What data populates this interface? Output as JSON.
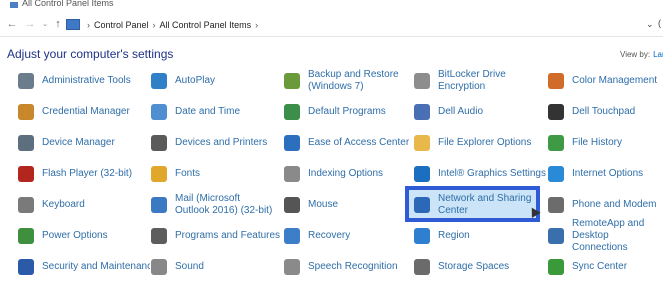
{
  "window": {
    "title": "All Control Panel Items"
  },
  "nav": {
    "back": "←",
    "forward": "→",
    "recent": "⌄",
    "up": "↑"
  },
  "address": {
    "crumbs": [
      "Control Panel",
      "All Control Panel Items"
    ],
    "separator": "›",
    "dropdown": "⌄",
    "refresh": "("
  },
  "heading": "Adjust your computer's settings",
  "view_by": {
    "label": "View by:",
    "value": "Larg"
  },
  "items": [
    {
      "label": "Administrative Tools",
      "icon": "administrative-tools-icon",
      "color": "#6b7d8c"
    },
    {
      "label": "AutoPlay",
      "icon": "autoplay-icon",
      "color": "#2f80c7"
    },
    {
      "label": "Backup and Restore (Windows 7)",
      "icon": "backup-restore-icon",
      "color": "#6a9a3a"
    },
    {
      "label": "BitLocker Drive Encryption",
      "icon": "bitlocker-icon",
      "color": "#8d8d8d"
    },
    {
      "label": "Color Management",
      "icon": "color-management-icon",
      "color": "#d06b2a"
    },
    {
      "label": "Credential Manager",
      "icon": "credential-manager-icon",
      "color": "#c9872c"
    },
    {
      "label": "Date and Time",
      "icon": "date-time-icon",
      "color": "#4f8fd1"
    },
    {
      "label": "Default Programs",
      "icon": "default-programs-icon",
      "color": "#3c8f4a"
    },
    {
      "label": "Dell Audio",
      "icon": "dell-audio-icon",
      "color": "#4a6fb5"
    },
    {
      "label": "Dell Touchpad",
      "icon": "dell-touchpad-icon",
      "color": "#333333"
    },
    {
      "label": "Device Manager",
      "icon": "device-manager-icon",
      "color": "#5d6f7e"
    },
    {
      "label": "Devices and Printers",
      "icon": "devices-printers-icon",
      "color": "#5a5a5a"
    },
    {
      "label": "Ease of Access Center",
      "icon": "ease-of-access-icon",
      "color": "#2c6fbf"
    },
    {
      "label": "File Explorer Options",
      "icon": "file-explorer-options-icon",
      "color": "#e8b84a"
    },
    {
      "label": "File History",
      "icon": "file-history-icon",
      "color": "#3f9a46"
    },
    {
      "label": "Flash Player (32-bit)",
      "icon": "flash-player-icon",
      "color": "#b3261e"
    },
    {
      "label": "Fonts",
      "icon": "fonts-icon",
      "color": "#e0a72a"
    },
    {
      "label": "Indexing Options",
      "icon": "indexing-options-icon",
      "color": "#8a8a8a"
    },
    {
      "label": "Intel® Graphics Settings",
      "icon": "intel-graphics-icon",
      "color": "#1a6fc0"
    },
    {
      "label": "Internet Options",
      "icon": "internet-options-icon",
      "color": "#2b8ad6"
    },
    {
      "label": "Keyboard",
      "icon": "keyboard-icon",
      "color": "#7a7a7a"
    },
    {
      "label": "Mail (Microsoft Outlook 2016) (32-bit)",
      "icon": "mail-icon",
      "color": "#3b79c2"
    },
    {
      "label": "Mouse",
      "icon": "mouse-icon",
      "color": "#555555"
    },
    {
      "label": "Network and Sharing Center",
      "icon": "network-sharing-icon",
      "color": "#2c68b8"
    },
    {
      "label": "Phone and Modem",
      "icon": "phone-modem-icon",
      "color": "#6c6c6c"
    },
    {
      "label": "Power Options",
      "icon": "power-options-icon",
      "color": "#3e8f3e"
    },
    {
      "label": "Programs and Features",
      "icon": "programs-features-icon",
      "color": "#5d5d5d"
    },
    {
      "label": "Recovery",
      "icon": "recovery-icon",
      "color": "#3d7ec9"
    },
    {
      "label": "Region",
      "icon": "region-icon",
      "color": "#2f7fd1"
    },
    {
      "label": "RemoteApp and Desktop Connections",
      "icon": "remoteapp-icon",
      "color": "#3a6fae"
    },
    {
      "label": "Security and Maintenance",
      "icon": "security-maintenance-icon",
      "color": "#2a5aa8"
    },
    {
      "label": "Sound",
      "icon": "sound-icon",
      "color": "#888888"
    },
    {
      "label": "Speech Recognition",
      "icon": "speech-recognition-icon",
      "color": "#8a8a8a"
    },
    {
      "label": "Storage Spaces",
      "icon": "storage-spaces-icon",
      "color": "#6b6b6b"
    },
    {
      "label": "Sync Center",
      "icon": "sync-center-icon",
      "color": "#3a9a3a"
    }
  ],
  "selected_item": "Network and Sharing Center"
}
